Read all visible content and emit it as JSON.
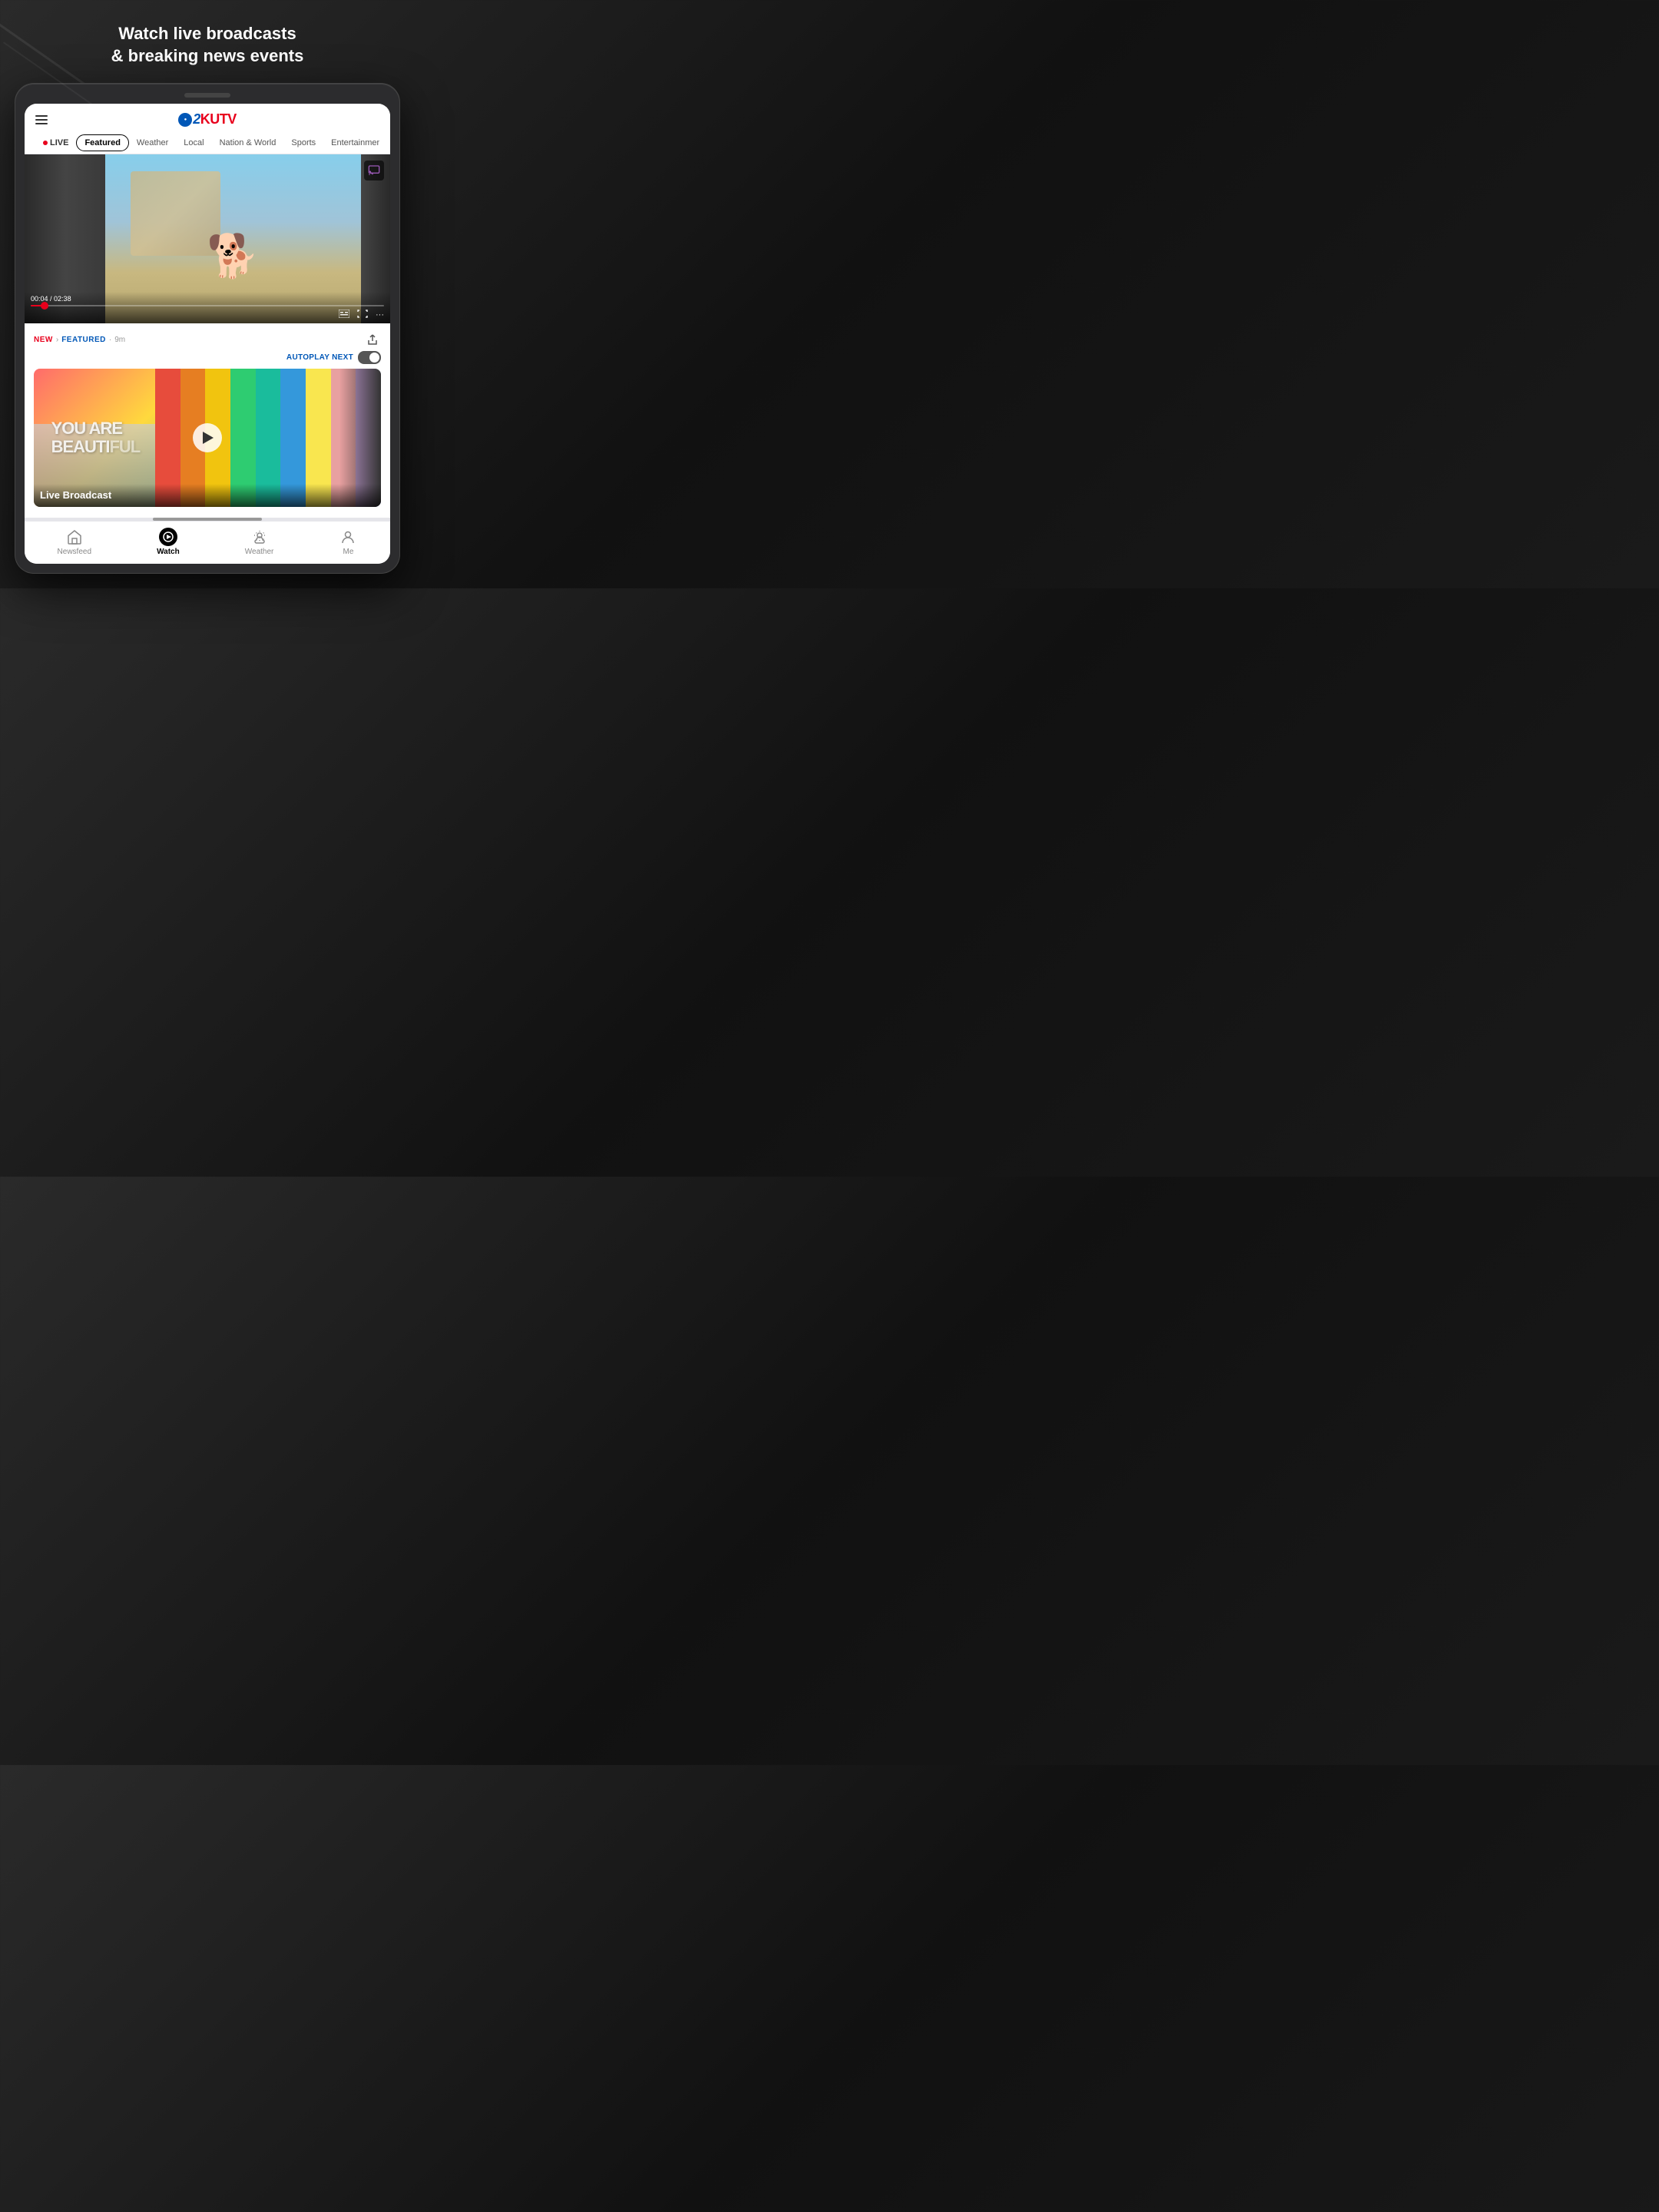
{
  "page": {
    "headline_line1": "Watch live broadcasts",
    "headline_line2": "& breaking news events"
  },
  "header": {
    "logo": {
      "channel": "2",
      "name": "KUTV"
    },
    "menu_label": "Menu"
  },
  "nav": {
    "tabs": [
      {
        "id": "live",
        "label": "LIVE",
        "type": "live"
      },
      {
        "id": "featured",
        "label": "Featured",
        "type": "active-pill"
      },
      {
        "id": "weather",
        "label": "Weather",
        "type": "normal"
      },
      {
        "id": "local",
        "label": "Local",
        "type": "normal"
      },
      {
        "id": "nation-world",
        "label": "Nation & World",
        "type": "normal"
      },
      {
        "id": "sports",
        "label": "Sports",
        "type": "normal"
      },
      {
        "id": "entertainment",
        "label": "Entertainment",
        "type": "normal"
      }
    ]
  },
  "video_player": {
    "time_current": "00:04",
    "time_total": "02:38",
    "progress_percent": 4
  },
  "article_meta": {
    "tag_new": "NEW",
    "tag_arrow": "›",
    "tag_featured": "FEATURED",
    "tag_time": "9m"
  },
  "autoplay": {
    "label": "AUTOPLAY NEXT",
    "enabled": true
  },
  "featured_card": {
    "title": "Live Broadcast",
    "mural_text": "YOU ARE\nBEAUTIFUL",
    "stripes": [
      {
        "color": "#ff6b6b"
      },
      {
        "color": "#ff9f43"
      },
      {
        "color": "#ffd93d"
      },
      {
        "color": "#c8e6c9"
      },
      {
        "color": "#4db6ac"
      },
      {
        "color": "#4fc3f7"
      },
      {
        "color": "#fff176"
      },
      {
        "color": "#ef9a9a"
      },
      {
        "color": "#ce93d8"
      }
    ]
  },
  "bottom_nav": {
    "items": [
      {
        "id": "newsfeed",
        "label": "Newsfeed",
        "icon": "home-icon",
        "active": false
      },
      {
        "id": "watch",
        "label": "Watch",
        "icon": "watch-icon",
        "active": true
      },
      {
        "id": "weather",
        "label": "Weather",
        "icon": "weather-icon",
        "active": false
      },
      {
        "id": "me",
        "label": "Me",
        "icon": "me-icon",
        "active": false
      }
    ]
  }
}
